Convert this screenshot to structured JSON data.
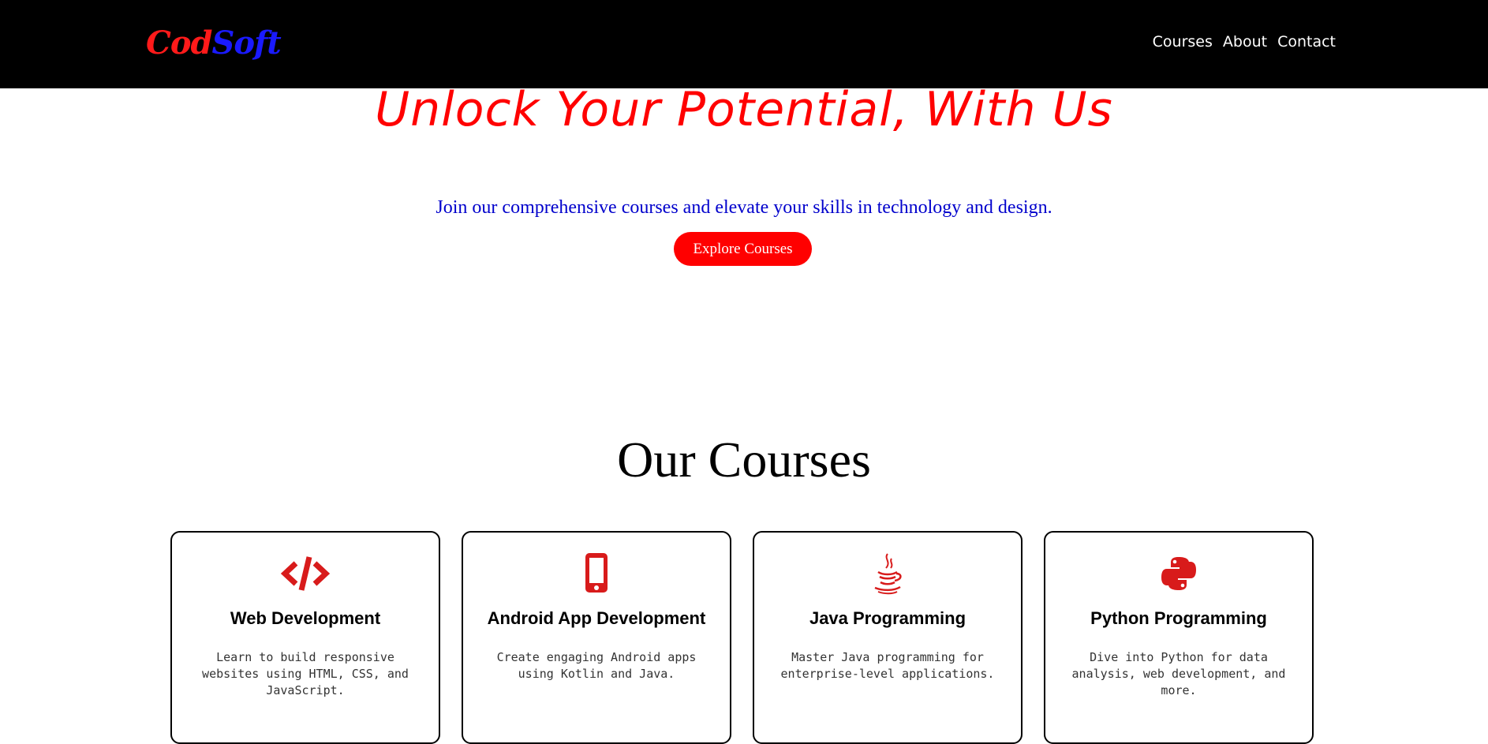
{
  "nav": {
    "logo": {
      "part_a": "Cod",
      "part_b": "Soft"
    },
    "links": [
      "Courses",
      "About",
      "Contact"
    ]
  },
  "hero": {
    "title": "Unlock Your Potential, With Us",
    "subtitle": "Join our comprehensive courses and elevate your skills in technology and design.",
    "cta_label": "Explore Courses"
  },
  "courses": {
    "heading": "Our Courses",
    "items": [
      {
        "icon": "code-icon",
        "title": "Web Development",
        "description": "Learn to build responsive websites using HTML, CSS, and JavaScript."
      },
      {
        "icon": "mobile-phone-icon",
        "title": "Android App Development",
        "description": "Create engaging Android apps using Kotlin and Java."
      },
      {
        "icon": "java-coffee-icon",
        "title": "Java Programming",
        "description": "Master Java programming for enterprise-level applications."
      },
      {
        "icon": "python-icon",
        "title": "Python Programming",
        "description": "Dive into Python for data analysis, web development, and more."
      }
    ]
  },
  "colors": {
    "accent": "#ff0000",
    "subtitle_blue": "#0000cc",
    "logo_blue": "#1a1aff",
    "icon_red": "#d81b1b",
    "nav_bg": "#000000"
  }
}
